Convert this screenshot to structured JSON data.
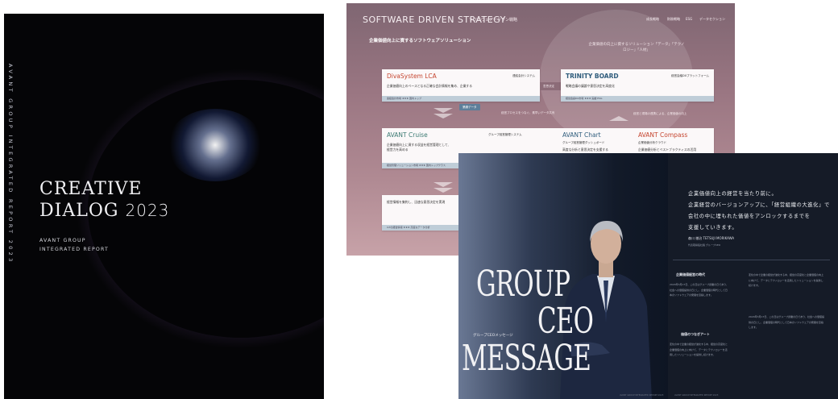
{
  "cover": {
    "vertical_text": "AVANT GROUP INTEGRATED REPORT 2023",
    "title_line1": "CREATIVE",
    "title_line2": "DIALOG",
    "title_year": "2023",
    "sub_line1": "AVANT GROUP",
    "sub_line2": "INTEGRATED REPORT"
  },
  "strategy": {
    "heading": "SOFTWARE DRIVEN STRATEGY",
    "heading_sub": "ソフトウェアドリブン戦略",
    "nav": [
      "成長戦略",
      "財務戦略",
      "ESG",
      "データセクション"
    ],
    "lead": "企業価値向上に資するソフトウェアソリューション",
    "halo_text": "企業価値の向上に資するソリューション「データ」「テクノロジー」「人材」",
    "cards": {
      "dsl": {
        "name": "DivaSystem LCA",
        "tag": "連結会計システム",
        "body": "企業価値向上のベースとなる正確な会計情報を集め、企業する",
        "bar": "連結会計市場  ★★★  国内トップ"
      },
      "trinity": {
        "name": "TRINITY BOARD",
        "tag": "経営会議DXプラットフォーム",
        "body": "戦略会議の議論や意思決定を高度化",
        "bar": "経営会議DX市場  ★★★  実績  ESG"
      },
      "cruise": {
        "name": "AVANT Cruise",
        "tag": "グループ経営管理システム",
        "body": "企業価値向上に資する収益を経営管理として、経営力を高める",
        "bar": "経営管理ソリューション市場  ★★★  国内トップクラス"
      },
      "chart": {
        "name": "AVANT Chart",
        "tag": "グループ経営管理ダッシュボード",
        "body": "高度な分析と意思決定を支援する"
      },
      "compass": {
        "name": "AVANT Compass",
        "tag": "企業価値分析クラウド",
        "body": "企業価値分析とベストプラクティスの活用"
      },
      "bottom": {
        "body": "経営情報を集約し、迅速な意思決定を実現",
        "bar": "IoTの経営情報  ★★★  高度なデータ分析"
      }
    },
    "arrow1": "意思決定",
    "pill1": "業績データ",
    "pill2": "連結データ",
    "note1": "経営プロセスをつなぐ、素早いデータ共有",
    "note2": "経営と現場の連携による、企業価値の向上"
  },
  "ceo": {
    "headline_l1": "企業価値向上の経営を当たり前に。",
    "headline_l2": "企業経営のバージョンアップに、「経営組織の大進化」で",
    "headline_l3": "会社の中に埋もれた価値をアンロックするまでを",
    "headline_l4": "支援していきます。",
    "signature": "森川 徹治 TETSUJI MORIKAWA",
    "signature_title": "代表取締役社長  グループCEO",
    "big_line1": "GROUP",
    "big_line2": "CEO",
    "big_line3": "MESSAGE",
    "small_label": "グループCEOメッセージ",
    "col1_head": "企業価値経営の時代",
    "col1_head2": "価値のつなぎアート",
    "col1_text": "2024年3月17日、この日はグループ創業の日であり、社会への価値提供の日とし、企業価値の時代として日本のソフトウェアの発展を目指します。",
    "col2_text": "変化の中で企業の経営が進化する中、経営の高度化と企業価値の向上に向けて、データとテクノロジーを活用したソリューションを提供し続けます。",
    "footer_left": "AVANT GROUP  INTEGRATED REPORT 2023",
    "footer_right": "AVANT GROUP  INTEGRATED REPORT 2023"
  }
}
